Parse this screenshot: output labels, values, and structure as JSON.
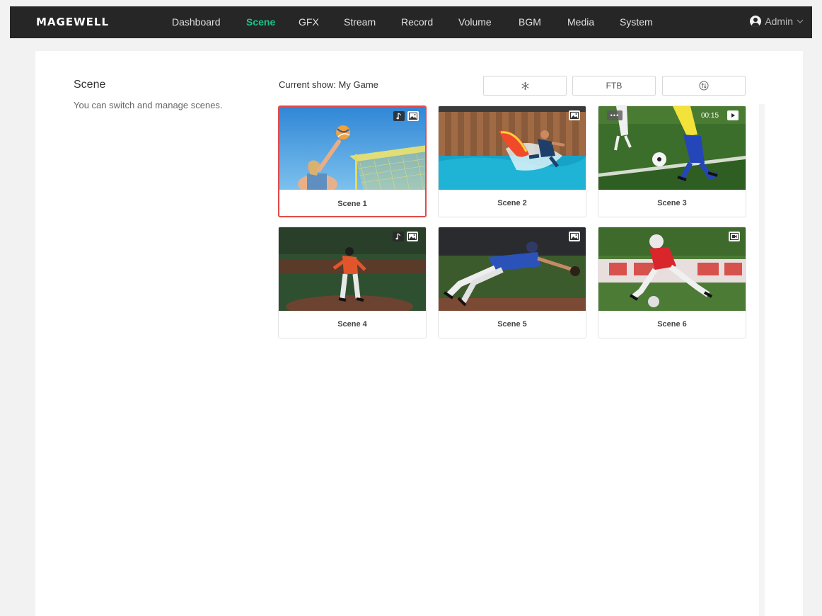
{
  "header": {
    "logo": "MAGEWELL",
    "nav": [
      {
        "label": "Dashboard",
        "active": false
      },
      {
        "label": "Scene",
        "active": true
      },
      {
        "label": "GFX",
        "active": false
      },
      {
        "label": "Stream",
        "active": false
      },
      {
        "label": "Record",
        "active": false
      },
      {
        "label": "Volume",
        "active": false
      },
      {
        "label": "BGM",
        "active": false
      },
      {
        "label": "Media",
        "active": false
      },
      {
        "label": "System",
        "active": false
      }
    ],
    "user": {
      "name": "Admin",
      "icon": "user-avatar-icon",
      "dropdown_icon": "chevron-down-icon"
    }
  },
  "section": {
    "title": "Scene",
    "description": "You can switch and manage scenes."
  },
  "toolbar": {
    "current_show": "Current show: My Game",
    "buttons": [
      {
        "name": "freeze-button",
        "icon": "snowflake-icon",
        "label": ""
      },
      {
        "name": "ftb-button",
        "icon": "",
        "label": "FTB"
      },
      {
        "name": "swap-button",
        "icon": "swap-circle-icon",
        "label": ""
      }
    ]
  },
  "scenes": [
    {
      "label": "Scene 1",
      "selected": true,
      "badges": [
        "audio-note-icon",
        "image-icon"
      ],
      "subject": "beach volleyball"
    },
    {
      "label": "Scene 2",
      "selected": false,
      "badges": [
        "image-icon"
      ],
      "subject": "surfing"
    },
    {
      "label": "Scene 3",
      "selected": false,
      "badges": [
        "more-dots-icon",
        "00:15",
        "play-icon"
      ],
      "subject": "soccer"
    },
    {
      "label": "Scene 4",
      "selected": false,
      "badges": [
        "audio-note-icon",
        "image-icon"
      ],
      "subject": "baseball pitcher"
    },
    {
      "label": "Scene 5",
      "selected": false,
      "badges": [
        "image-icon"
      ],
      "subject": "baseball dive"
    },
    {
      "label": "Scene 6",
      "selected": false,
      "badges": [
        "video-camera-icon"
      ],
      "subject": "football"
    }
  ],
  "scene3_time": "00:15",
  "colors": {
    "accent": "#19c38a",
    "selected_border": "#e24c4c",
    "topbar": "#262626"
  }
}
